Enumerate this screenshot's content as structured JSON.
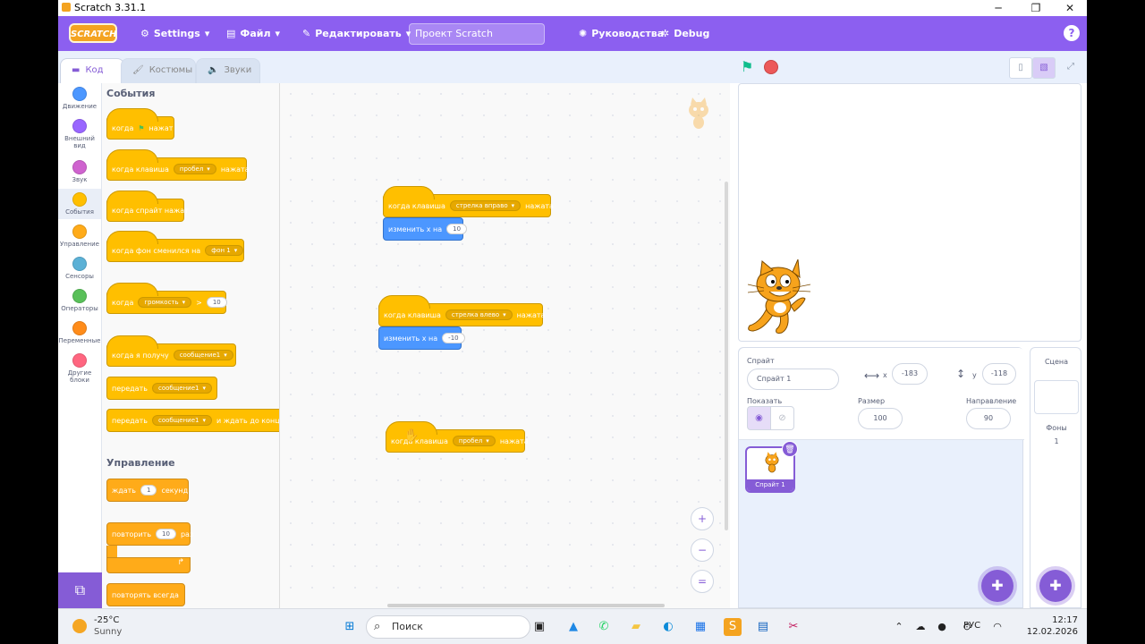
{
  "window": {
    "title": "Scratch 3.31.1",
    "min": "─",
    "max": "❐",
    "close": "✕"
  },
  "menubar": {
    "logo": "SCRATCH",
    "settings": "Settings",
    "file": "Файл",
    "edit": "Редактировать",
    "project_title": "Проект Scratch",
    "tutorials": "Руководства",
    "debug": "Debug",
    "help": "?"
  },
  "tabs": {
    "code": "Код",
    "costumes": "Костюмы",
    "sounds": "Звуки"
  },
  "categories": [
    {
      "label": "Движение",
      "color": "#4c97ff"
    },
    {
      "label": "Внешний вид",
      "color": "#9966ff"
    },
    {
      "label": "Звук",
      "color": "#cf63cf"
    },
    {
      "label": "События",
      "color": "#ffbf00"
    },
    {
      "label": "Управление",
      "color": "#ffab19"
    },
    {
      "label": "Сенсоры",
      "color": "#5cb1d6"
    },
    {
      "label": "Операторы",
      "color": "#59c059"
    },
    {
      "label": "Переменные",
      "color": "#ff8c1a"
    },
    {
      "label": "Другие блоки",
      "color": "#ff6680"
    }
  ],
  "palette": {
    "events_title": "События",
    "control_title": "Управление",
    "when_flag_1": "когда",
    "when_flag_2": "нажат",
    "when_key": "когда клавиша",
    "key_space": "пробел",
    "pressed": "нажата",
    "when_sprite_clicked": "когда спрайт нажат",
    "when_backdrop": "когда фон сменился на",
    "backdrop1": "фон 1",
    "when": "когда",
    "loudness": "громкость",
    "gt": ">",
    "val10": "10",
    "when_receive": "когда я получу",
    "message1": "сообщение1",
    "broadcast": "передать",
    "and_wait": "и ждать до конца",
    "wait": "ждать",
    "one": "1",
    "seconds": "секунд",
    "repeat": "повторить",
    "times": "раз",
    "forever": "повторять всегда"
  },
  "workspace": {
    "script1": {
      "when_key": "когда клавиша",
      "key": "стрелка вправо",
      "pressed": "нажата",
      "change_x": "изменить х на",
      "value": "10"
    },
    "script2": {
      "when_key": "когда клавиша",
      "key": "стрелка влево",
      "pressed": "нажата",
      "change_x": "изменить х на",
      "value": "-10"
    },
    "script3": {
      "when_key": "когда клавиша",
      "key": "пробел",
      "pressed": "нажата"
    },
    "zoom_in": "+",
    "zoom_out": "−",
    "zoom_reset": "="
  },
  "sprite_info": {
    "sprite_label": "Спрайт",
    "sprite_name": "Спрайт 1",
    "x_label": "x",
    "x_value": "-183",
    "y_label": "y",
    "y_value": "-118",
    "show_label": "Показать",
    "size_label": "Размер",
    "size_value": "100",
    "direction_label": "Направление",
    "direction_value": "90"
  },
  "sprite_list": [
    {
      "name": "Спрайт 1"
    }
  ],
  "scene": {
    "title": "Сцена",
    "backdrops_label": "Фоны",
    "backdrops_count": "1"
  },
  "taskbar": {
    "temperature": "-25°C",
    "weather": "Sunny",
    "search": "Поиск",
    "language": "РУС",
    "time": "12:17",
    "date": "12.02.2026"
  },
  "colors": {
    "accent": "#855cd6",
    "menubar": "#8c5ff0",
    "events": "#ffbf00",
    "motion": "#4c97ff",
    "control": "#ffab19"
  }
}
